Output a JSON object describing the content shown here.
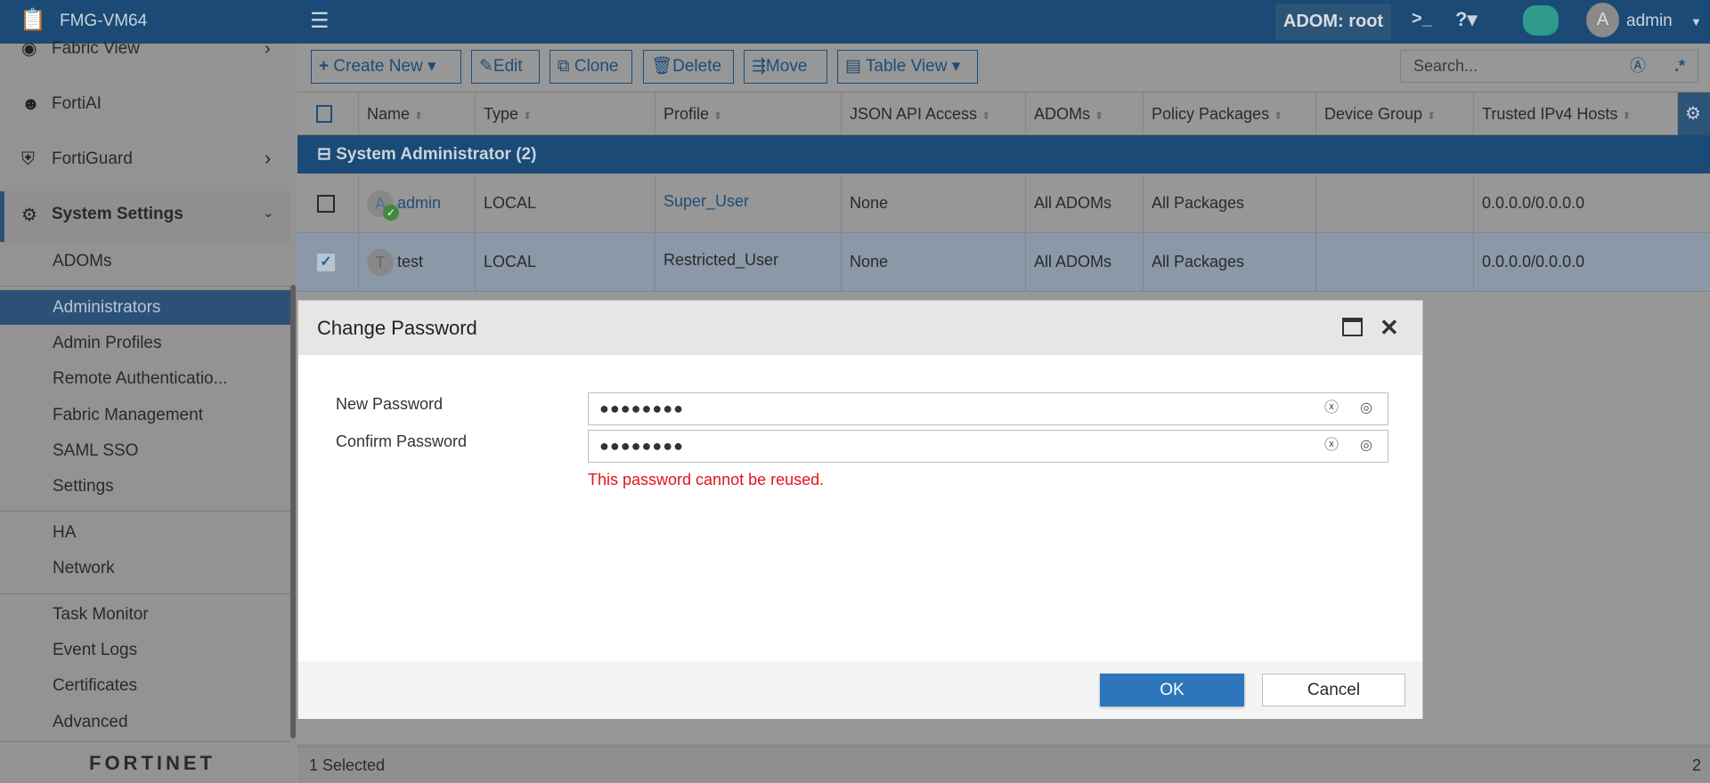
{
  "header": {
    "app_name": "FMG-VM64",
    "adom": "ADOM: root",
    "user": "admin",
    "user_initial": "A"
  },
  "sidebar": {
    "top_items": [
      {
        "label": "Fabric View"
      },
      {
        "label": "FortiAI"
      },
      {
        "label": "FortiGuard"
      },
      {
        "label": "System Settings"
      }
    ],
    "sub_items": [
      "ADOMs",
      "Administrators",
      "Admin Profiles",
      "Remote Authenticatio...",
      "Fabric Management",
      "SAML SSO",
      "Settings",
      "HA",
      "Network",
      "Task Monitor",
      "Event Logs",
      "Certificates",
      "Advanced"
    ],
    "logo": "FORTINET"
  },
  "toolbar": {
    "create_new": "Create New",
    "edit": "Edit",
    "clone": "Clone",
    "delete": "Delete",
    "move": "Move",
    "table_view": "Table View",
    "search_placeholder": "Search..."
  },
  "table": {
    "columns": [
      "Name",
      "Type",
      "Profile",
      "JSON API Access",
      "ADOMs",
      "Policy Packages",
      "Device Group",
      "Trusted IPv4 Hosts"
    ],
    "group": "System Administrator (2)",
    "rows": [
      {
        "initial": "A",
        "name": "admin",
        "type": "LOCAL",
        "profile": "Super_User",
        "json": "None",
        "adoms": "All ADOMs",
        "packages": "All Packages",
        "device_group": "",
        "hosts": "0.0.0.0/0.0.0.0",
        "selected": false
      },
      {
        "initial": "T",
        "name": "test",
        "type": "LOCAL",
        "profile": "Restricted_User",
        "json": "None",
        "adoms": "All ADOMs",
        "packages": "All Packages",
        "device_group": "",
        "hosts": "0.0.0.0/0.0.0.0",
        "selected": true
      }
    ]
  },
  "dialog": {
    "title": "Change Password",
    "new_password_label": "New Password",
    "confirm_password_label": "Confirm Password",
    "new_password_value": "●●●●●●●●",
    "confirm_password_value": "●●●●●●●●",
    "error": "This password cannot be reused.",
    "ok": "OK",
    "cancel": "Cancel"
  },
  "status": {
    "selected": "1 Selected",
    "total": "2"
  }
}
